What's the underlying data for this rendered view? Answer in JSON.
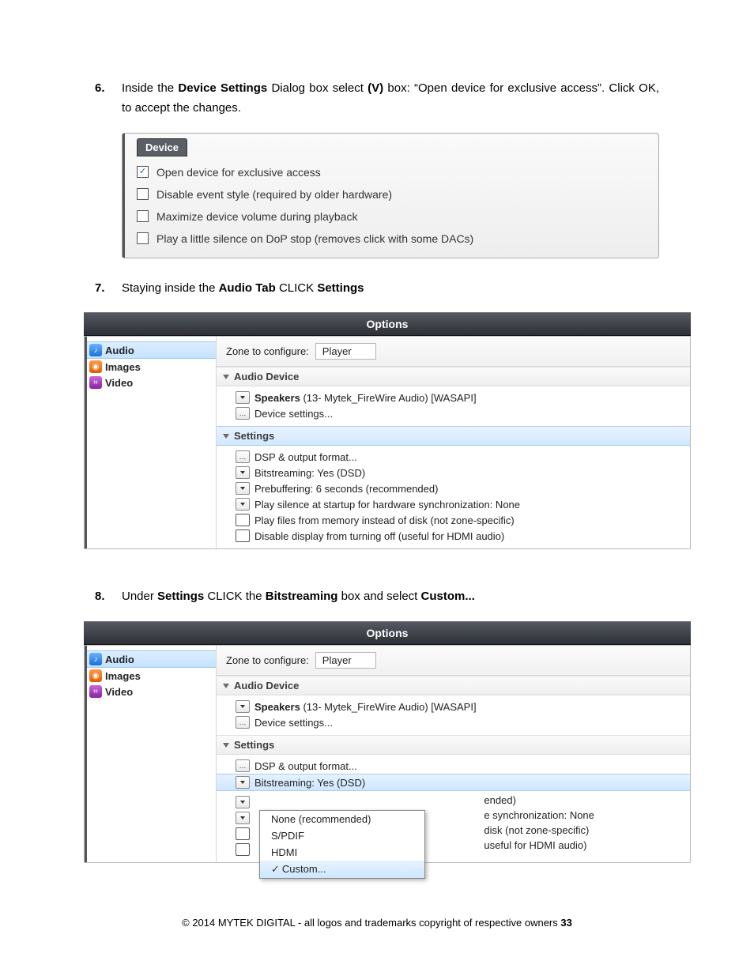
{
  "steps": {
    "s6": {
      "num": "6.",
      "t1": "Inside the ",
      "b1": "Device Settings",
      "t2": " Dialog box select ",
      "b2": "(V)",
      "t3": " box: “Open device for exclusive access”. Click OK, to accept the changes."
    },
    "s7": {
      "num": "7.",
      "t1": "Staying inside the ",
      "b1": "Audio Tab",
      "t2": " CLICK ",
      "b2": "Settings"
    },
    "s8": {
      "num": "8.",
      "t1": "Under ",
      "b1": "Settings",
      "t2": " CLICK the ",
      "b2": "Bitstreaming",
      "t3": " box and select ",
      "b3": "Custom..."
    }
  },
  "device_panel": {
    "tag": "Device",
    "rows": [
      {
        "label": "Open device for exclusive access",
        "checked": true
      },
      {
        "label": "Disable event style (required by older hardware)",
        "checked": false
      },
      {
        "label": "Maximize device volume during playback",
        "checked": false
      },
      {
        "label": "Play a little silence on DoP stop (removes click with some DACs)",
        "checked": false
      }
    ]
  },
  "options_title": "Options",
  "sidebar": {
    "audio": "Audio",
    "images": "Images",
    "video": "Video"
  },
  "zone": {
    "label": "Zone to configure:",
    "value": "Player"
  },
  "sections": {
    "audio_device": "Audio Device",
    "settings": "Settings"
  },
  "audio_device_rows": {
    "speakers_b": "Speakers",
    "speakers_t": " (13- Mytek_FireWire Audio) [WASAPI]",
    "devset": "Device settings..."
  },
  "settings_rows": {
    "dsp": "DSP & output format...",
    "bitstream": "Bitstreaming: Yes (DSD)",
    "prebuf": "Prebuffering: 6 seconds (recommended)",
    "silence": "Play silence at startup for hardware synchronization: None",
    "memory": "Play files from memory instead of disk (not zone-specific)",
    "display": "Disable display from turning off (useful for HDMI audio)"
  },
  "popup": {
    "none": "None (recommended)",
    "spdif": "S/PDIF",
    "hdmi": "HDMI",
    "custom": "Custom..."
  },
  "peek": {
    "a": "ended)",
    "b": "e synchronization: None",
    "c": "disk (not zone-specific)",
    "d": "useful for HDMI audio)"
  },
  "footer": {
    "text": "© 2014 MYTEK DIGITAL - all logos and trademarks copyright of respective owners  ",
    "page": "33"
  }
}
